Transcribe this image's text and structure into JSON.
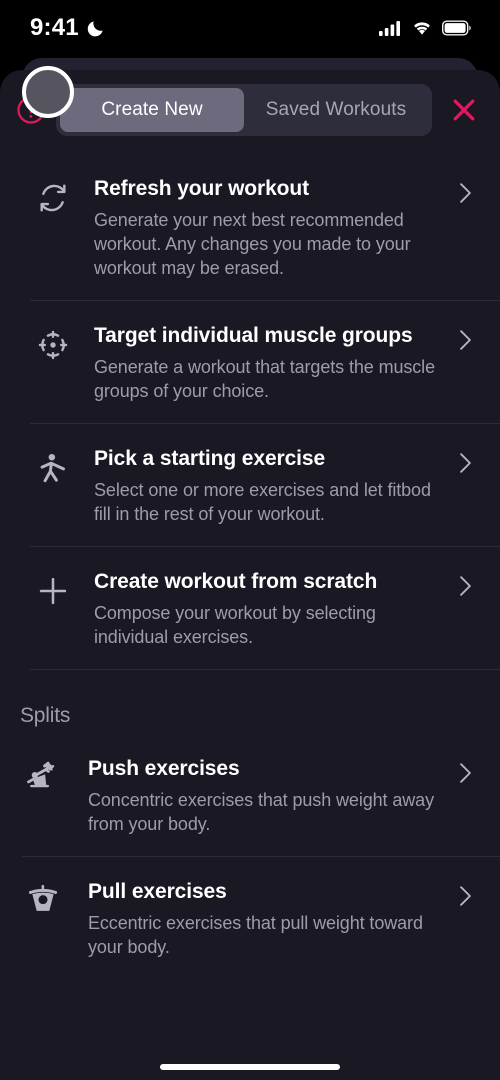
{
  "status_bar": {
    "time": "9:41",
    "dnd_icon": "crescent-moon-icon",
    "cellular_icon": "cellular-bars-icon",
    "wifi_icon": "wifi-icon",
    "battery_icon": "battery-full-icon"
  },
  "header": {
    "help_icon": "help-question-circle-icon",
    "close_icon": "close-x-icon",
    "tabs": [
      {
        "label": "Create New",
        "active": true
      },
      {
        "label": "Saved Workouts",
        "active": false
      }
    ]
  },
  "colors": {
    "accent": "#e8175d",
    "sheet_bg": "#191823",
    "segment_bg": "#2e2d3b",
    "segment_active": "#6d6a7d",
    "title_text": "#ffffff",
    "body_text": "#9e9cab",
    "divider": "#2c2b38"
  },
  "main": {
    "options": [
      {
        "icon": "refresh-icon",
        "title": "Refresh your workout",
        "description": "Generate your next best recommended workout. Any changes you made to your workout may be erased.",
        "chevron": "chevron-right-icon"
      },
      {
        "icon": "target-crosshair-icon",
        "title": "Target individual muscle groups",
        "description": "Generate a workout that targets the muscle groups of your choice.",
        "chevron": "chevron-right-icon"
      },
      {
        "icon": "person-exercise-icon",
        "title": "Pick a starting exercise",
        "description": "Select one or more exercises and let fitbod fill in the rest of your workout.",
        "chevron": "chevron-right-icon"
      },
      {
        "icon": "plus-icon",
        "title": "Create workout from scratch",
        "description": "Compose your workout by selecting individual exercises.",
        "chevron": "chevron-right-icon"
      }
    ]
  },
  "splits": {
    "section_label": "Splits",
    "items": [
      {
        "icon": "bench-press-push-icon",
        "title": "Push exercises",
        "description": "Concentric exercises that push weight away from your body.",
        "chevron": "chevron-right-icon"
      },
      {
        "icon": "pull-up-icon",
        "title": "Pull exercises",
        "description": "Eccentric exercises that pull weight toward your body.",
        "chevron": "chevron-right-icon"
      }
    ]
  }
}
